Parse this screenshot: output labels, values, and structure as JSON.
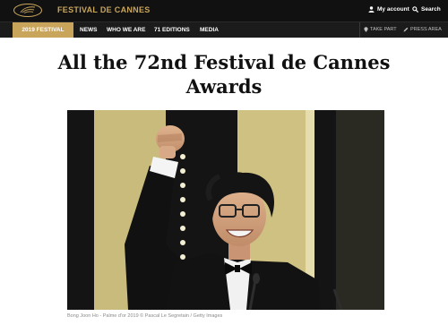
{
  "header": {
    "brand": "FESTIVAL DE CANNES",
    "account_label": "My account",
    "search_label": "Search"
  },
  "nav": {
    "active": "2019 FESTIVAL",
    "items": [
      "NEWS",
      "WHO WE ARE",
      "71 EDITIONS",
      "MEDIA"
    ],
    "take_part": "TAKE PART",
    "press_area": "PRESS AREA"
  },
  "article": {
    "title": "All the 72nd Festival de Cannes Awards",
    "caption": "Bong Joon Ho - Palme d'or 2019 © Pascal Le Segretain / Getty Images"
  },
  "colors": {
    "gold": "#c9a55c",
    "topbar": "#111111",
    "navbar": "#1b1b1b"
  },
  "icons": {
    "logo": "palm-leaf-logo",
    "account": "user-icon",
    "search": "search-icon",
    "take_part": "location-pin-icon",
    "press_area": "pencil-icon"
  }
}
